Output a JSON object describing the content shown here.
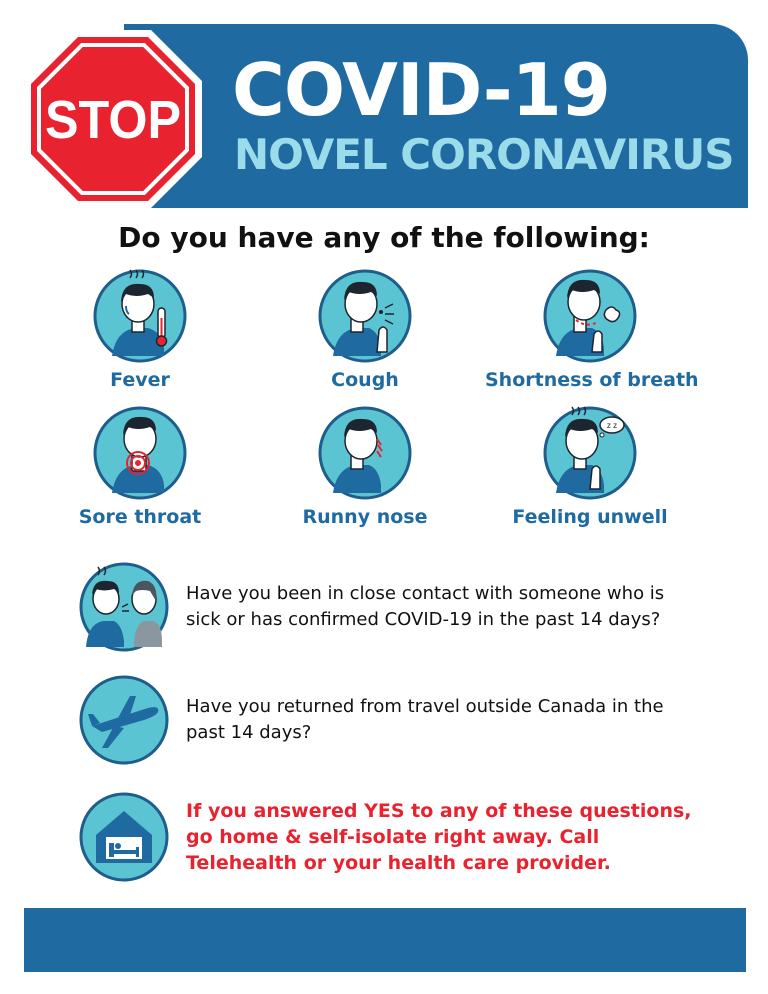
{
  "header": {
    "stop_text": "STOP",
    "title": "COVID-19",
    "subtitle": "NOVEL CORONAVIRUS"
  },
  "question": "Do you have any of the following:",
  "symptoms": [
    {
      "label": "Fever",
      "icon": "fever-icon"
    },
    {
      "label": "Cough",
      "icon": "cough-icon"
    },
    {
      "label": "Shortness of breath",
      "icon": "shortness-of-breath-icon"
    },
    {
      "label": "Sore throat",
      "icon": "sore-throat-icon"
    },
    {
      "label": "Runny nose",
      "icon": "runny-nose-icon"
    },
    {
      "label": "Feeling unwell",
      "icon": "feeling-unwell-icon"
    }
  ],
  "questions": {
    "contact": "Have you been in close contact with someone who is sick or has confirmed COVID-19 in the past 14 days?",
    "travel": "Have you returned from travel outside Canada in the past 14 days?",
    "advice": "If you answered YES to any of these questions, go home & self-isolate right away. Call Telehealth or your health care provider."
  },
  "colors": {
    "brand_blue": "#1f6aa1",
    "icon_teal": "#5bc4d2",
    "stop_red": "#e8232f",
    "subtitle": "#9bdcea"
  }
}
